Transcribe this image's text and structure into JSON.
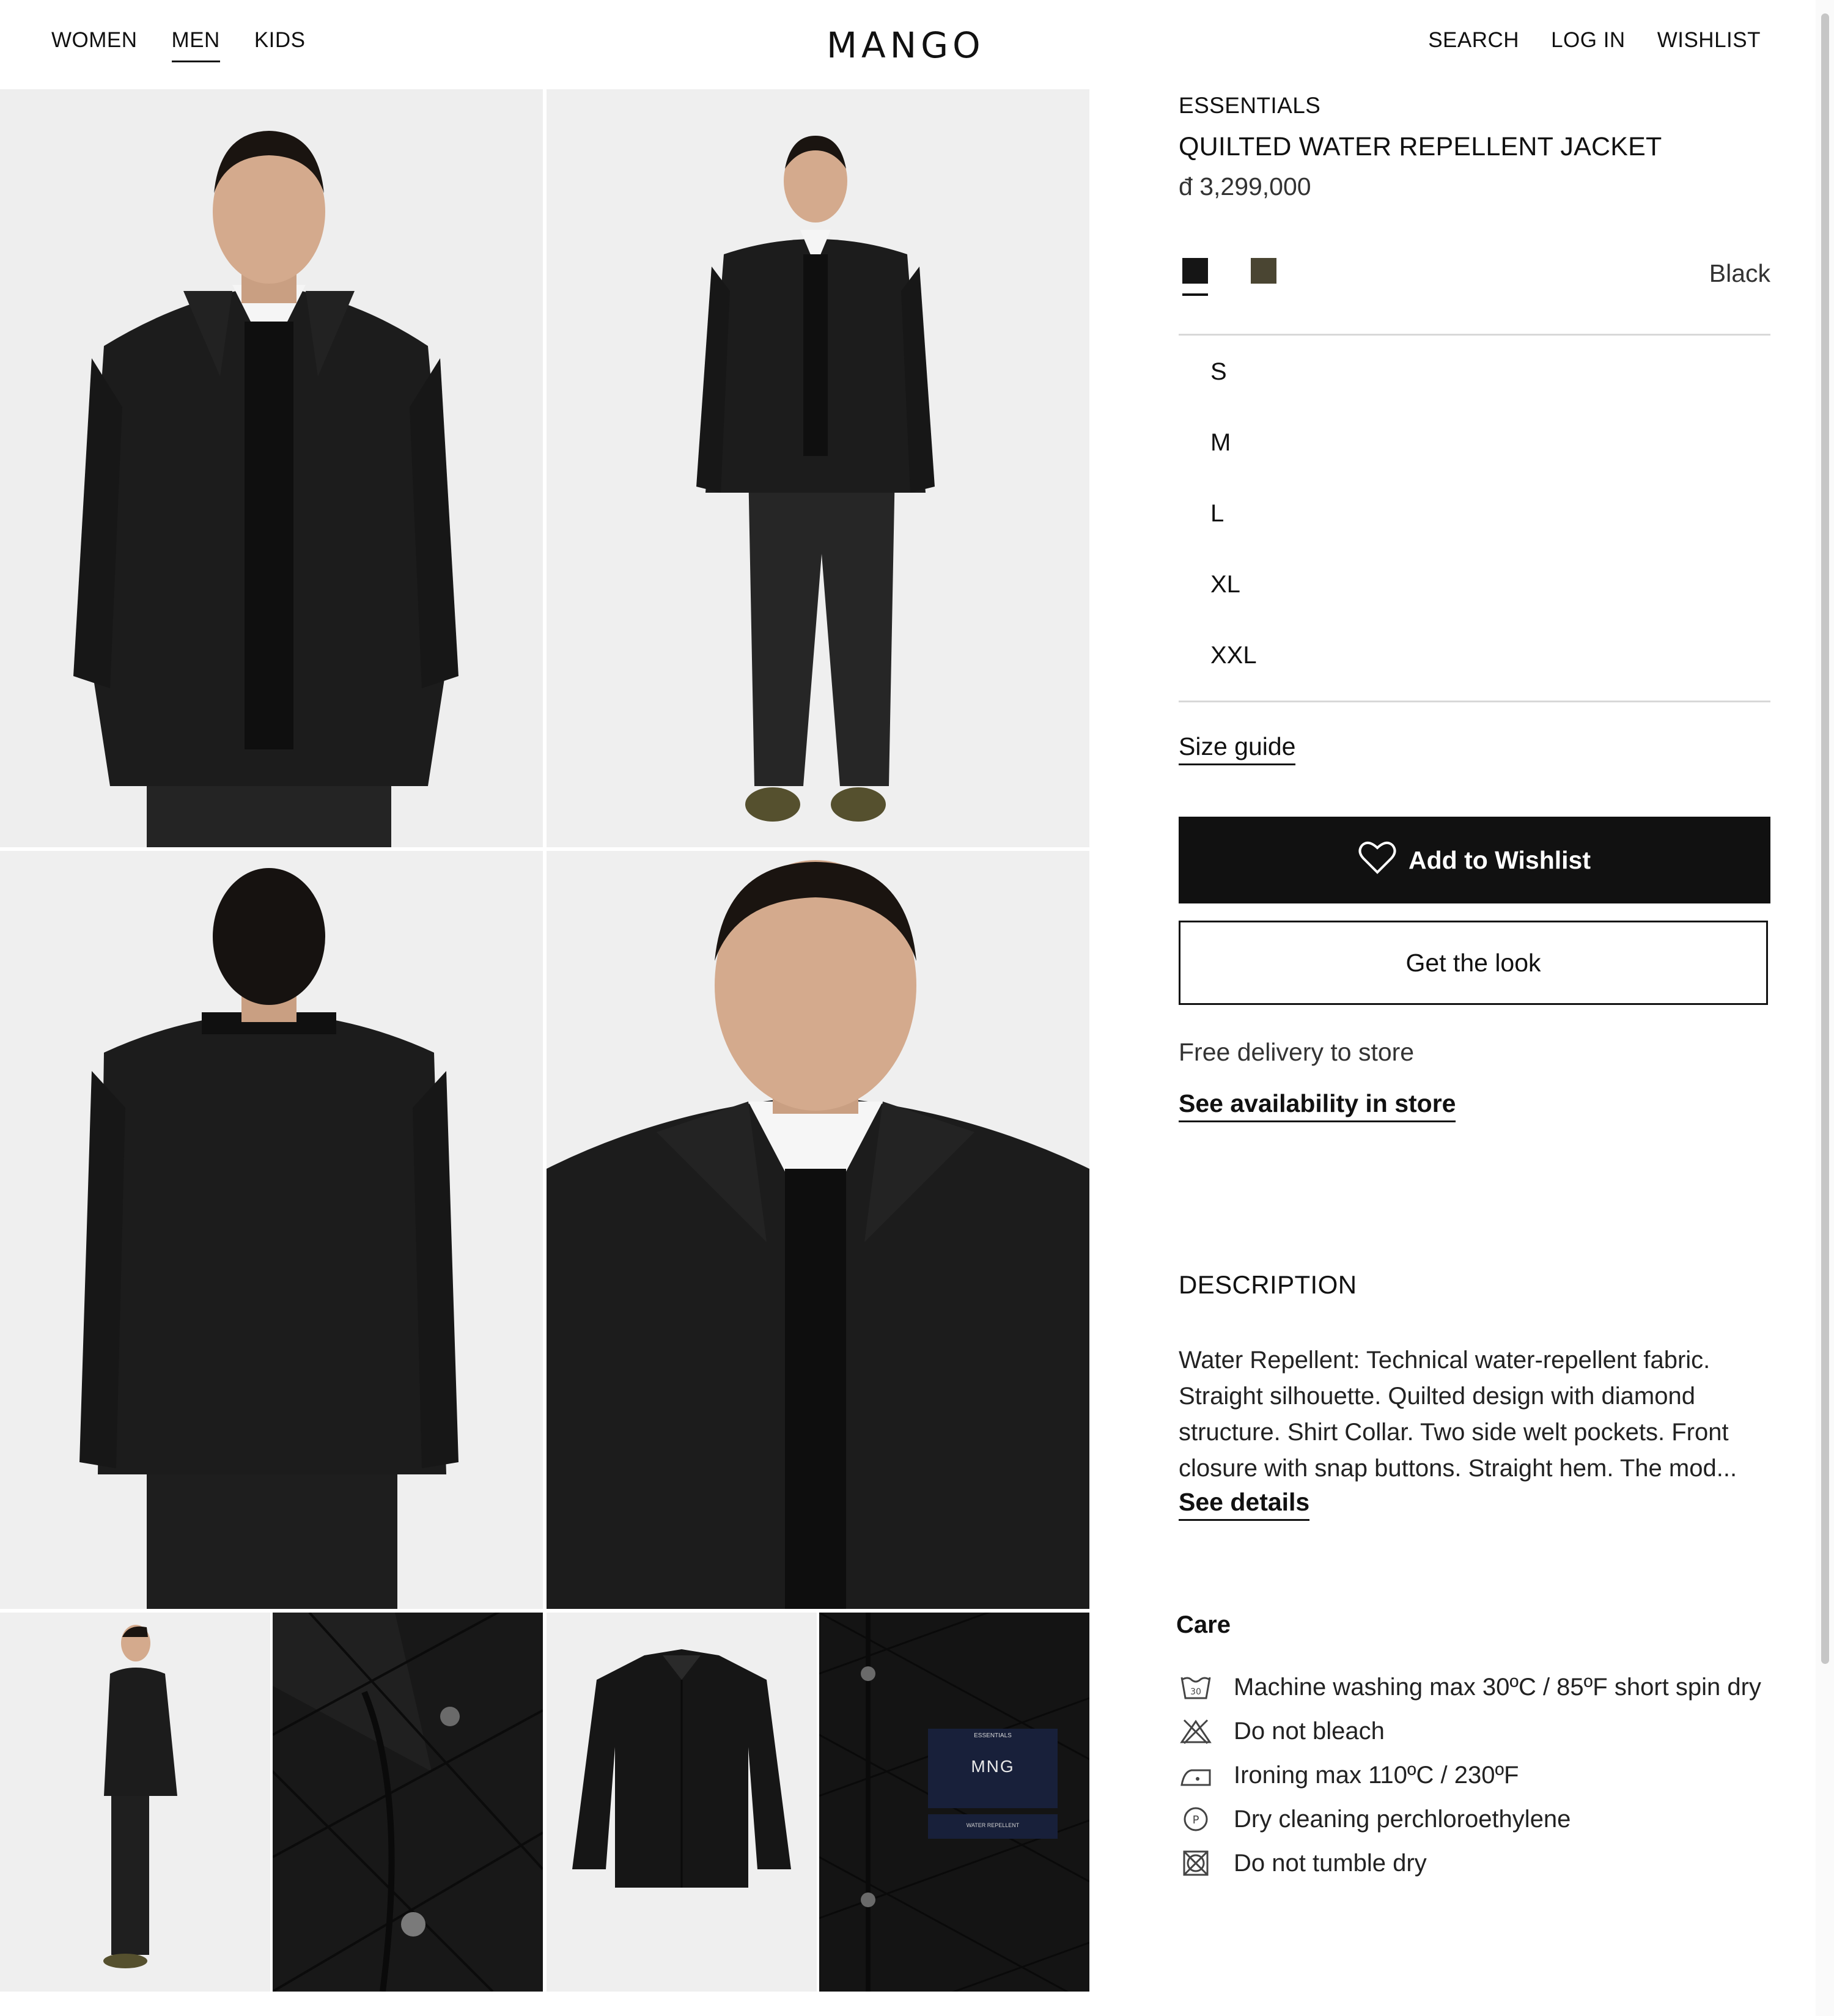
{
  "header": {
    "nav_left": [
      "WOMEN",
      "MEN",
      "KIDS"
    ],
    "logo": "MANGO",
    "nav_right": [
      "SEARCH",
      "LOG IN",
      "WISHLIST"
    ]
  },
  "product": {
    "line": "ESSENTIALS",
    "title": "QUILTED WATER REPELLENT JACKET",
    "price": "đ 3,299,000",
    "colors": [
      {
        "name": "Black",
        "hex": "#151515"
      },
      {
        "name": "Khaki",
        "hex": "#4a4532"
      }
    ],
    "selected_color": "Black",
    "sizes": [
      "S",
      "M",
      "L",
      "XL",
      "XXL"
    ],
    "size_guide": "Size guide",
    "wishlist_button": "Add to Wishlist",
    "look_button": "Get the look",
    "delivery": "Free delivery to store",
    "availability_link": "See availability in store"
  },
  "description": {
    "title": "DESCRIPTION",
    "text": "Water Repellent: Technical water-repellent fabric. Straight silhouette. Quilted design with diamond structure. Shirt Collar. Two side welt pockets. Front closure with snap buttons. Straight hem. The mod...",
    "details_link": "See details"
  },
  "care": {
    "title": "Care",
    "items": [
      {
        "icon": "wash-30-icon",
        "text": "Machine washing max 30ºC / 85ºF short spin dry"
      },
      {
        "icon": "no-bleach-icon",
        "text": "Do not bleach"
      },
      {
        "icon": "iron-icon",
        "text": "Ironing max 110ºC / 230ºF"
      },
      {
        "icon": "dry-clean-p-icon",
        "text": "Dry cleaning perchloroethylene"
      },
      {
        "icon": "no-tumble-dry-icon",
        "text": "Do not tumble dry"
      }
    ]
  },
  "label_text": {
    "brand_top": "ESSENTIALS",
    "brand": "MNG",
    "bottom": "WATER REPELLENT"
  }
}
